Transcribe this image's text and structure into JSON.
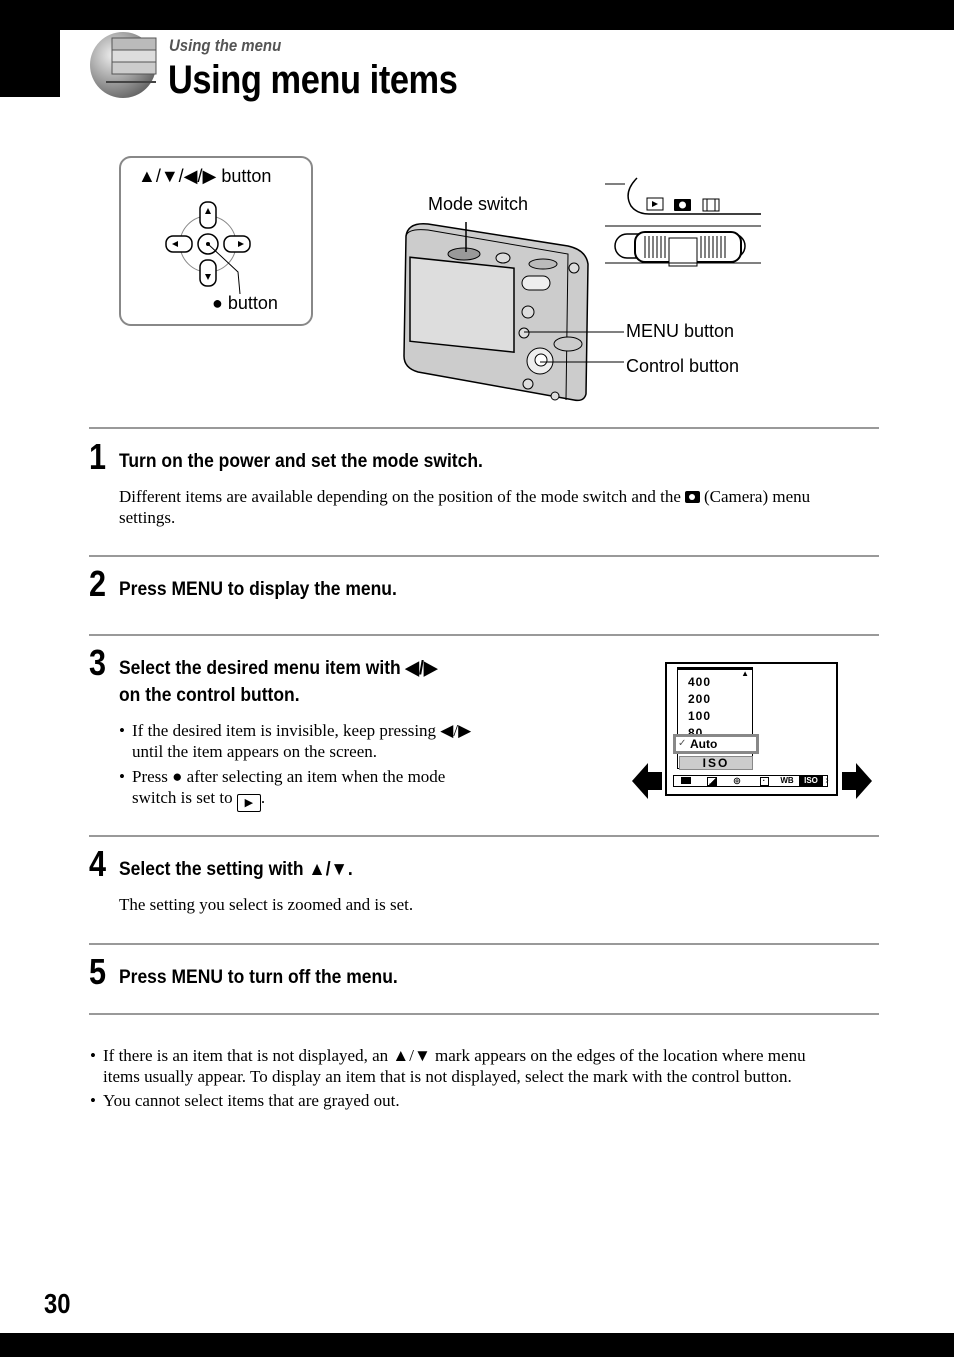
{
  "header": {
    "section": "Using the menu",
    "title": "Using menu items"
  },
  "diagram": {
    "dpad_label": "▲/▼/◀/▶ button",
    "center_label": "● button",
    "mode_switch_label": "Mode switch",
    "menu_button_label": "MENU button",
    "control_button_label": "Control button",
    "mode_icons": [
      "playback-icon",
      "camera-icon",
      "movie-icon"
    ]
  },
  "steps": [
    {
      "number": "1",
      "heading": "Turn on the power and set the mode switch.",
      "body_before": "Different items are available depending on the position of the mode switch and the",
      "body_after": "(Camera) menu",
      "body_line2": "settings."
    },
    {
      "number": "2",
      "heading": "Press MENU to display the menu."
    },
    {
      "number": "3",
      "heading_line1": "Select the desired menu item with ◀/▶",
      "heading_line2": "on the control button.",
      "bullets": [
        {
          "line1": "If the desired item is invisible, keep pressing ◀/▶",
          "line2": "until the item appears on the screen."
        },
        {
          "line1": "Press ● after selecting an item when the mode",
          "line2": "switch is set to",
          "line2_end": "."
        }
      ]
    },
    {
      "number": "4",
      "heading": "Select the setting with ▲/▼.",
      "body": "The setting you select is zoomed and is set."
    },
    {
      "number": "5",
      "heading": "Press MENU to turn off the menu."
    }
  ],
  "menu_screen": {
    "options": [
      "400",
      "200",
      "100",
      "80"
    ],
    "selected": "Auto",
    "selected_mark": "✓",
    "category": "ISO",
    "tabs": [
      "camera",
      "exposure",
      "focus",
      "metering",
      "WB",
      "ISO"
    ],
    "tab_wb": "WB",
    "tab_iso": "ISO",
    "more": "›"
  },
  "notes": [
    {
      "line1": "If there is an item that is not displayed, an ▲/▼ mark appears on the edges of the location where menu",
      "line2": "items usually appear. To display an item that is not displayed, select the mark with the control button."
    },
    {
      "line1": "You cannot select items that are grayed out."
    }
  ],
  "footer": {
    "page_number": "30"
  },
  "bullet": "•"
}
